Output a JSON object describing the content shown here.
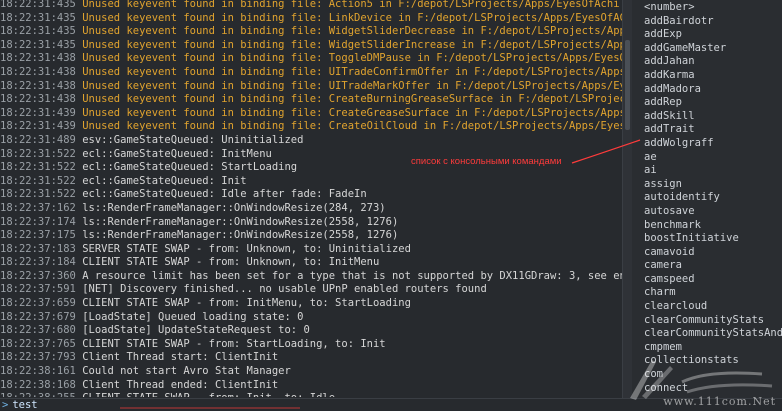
{
  "log": [
    {
      "time": "18:22:31:435",
      "level": "warn",
      "text": "Unused keyevent found in binding file: Action5 in F:/depot/LSProjects/Apps/EyesOfAchi"
    },
    {
      "time": "18:22:31:435",
      "level": "warn",
      "text": "Unused keyevent found in binding file: LinkDevice in F:/depot/LSProjects/Apps/EyesOfAC"
    },
    {
      "time": "18:22:31:435",
      "level": "warn",
      "text": "Unused keyevent found in binding file: WidgetSliderDecrease in F:/depot/LSProjects/App"
    },
    {
      "time": "18:22:31:435",
      "level": "warn",
      "text": "Unused keyevent found in binding file: WidgetSliderIncrease in F:/depot/LSProjects/App"
    },
    {
      "time": "18:22:31:438",
      "level": "warn",
      "text": "Unused keyevent found in binding file: ToggleDMPause in F:/depot/LSProjects/Apps/EyesO"
    },
    {
      "time": "18:22:31:438",
      "level": "warn",
      "text": "Unused keyevent found in binding file: UITradeConfirmOffer in F:/depot/LSProjects/Apps"
    },
    {
      "time": "18:22:31:438",
      "level": "warn",
      "text": "Unused keyevent found in binding file: UITradeMarkOffer in F:/depot/LSProjects/Apps/Ey"
    },
    {
      "time": "18:22:31:438",
      "level": "warn",
      "text": "Unused keyevent found in binding file: CreateBurningGreaseSurface in F:/depot/LSProjec"
    },
    {
      "time": "18:22:31:439",
      "level": "warn",
      "text": "Unused keyevent found in binding file: CreateGreaseSurface in F:/depot/LSProjects/Apps"
    },
    {
      "time": "18:22:31:439",
      "level": "warn",
      "text": "Unused keyevent found in binding file: CreateOilCloud in F:/depot/LSProjects/Apps/Eyes"
    },
    {
      "time": "18:22:31:489",
      "level": "info",
      "text": "esv::GameStateQueued: Uninitialized"
    },
    {
      "time": "18:22:31:522",
      "level": "info",
      "text": "ecl::GameStateQueued: InitMenu"
    },
    {
      "time": "18:22:31:522",
      "level": "info",
      "text": "ecl::GameStateQueued: StartLoading"
    },
    {
      "time": "18:22:31:522",
      "level": "info",
      "text": "ecl::GameStateQueued: Init"
    },
    {
      "time": "18:22:31:522",
      "level": "info",
      "text": "ecl::GameStateQueued: Idle after fade: FadeIn"
    },
    {
      "time": "18:22:37:162",
      "level": "info",
      "text": "ls::RenderFrameManager::OnWindowResize(284, 273)"
    },
    {
      "time": "18:22:37:174",
      "level": "info",
      "text": "ls::RenderFrameManager::OnWindowResize(2558, 1276)"
    },
    {
      "time": "18:22:37:175",
      "level": "info",
      "text": "ls::RenderFrameManager::OnWindowResize(2558, 1276)"
    },
    {
      "time": "18:22:37:183",
      "level": "info",
      "text": "SERVER STATE SWAP - from: Unknown, to: Uninitialized"
    },
    {
      "time": "18:22:37:184",
      "level": "info",
      "text": "CLIENT STATE SWAP - from: Unknown, to: InitMenu"
    },
    {
      "time": "18:22:37:360",
      "level": "info",
      "text": "A resource limit has been set for a type that is not supported by DX11GDraw: 3, see en"
    },
    {
      "time": "18:22:37:591",
      "level": "info",
      "text": "[NET] Discovery finished... no usable UPnP enabled routers found"
    },
    {
      "time": "18:22:37:659",
      "level": "info",
      "text": "CLIENT STATE SWAP - from: InitMenu, to: StartLoading"
    },
    {
      "time": "18:22:37:679",
      "level": "info",
      "text": "[LoadState] Queued loading state: 0"
    },
    {
      "time": "18:22:37:680",
      "level": "info",
      "text": "[LoadState] UpdateStateRequest to: 0"
    },
    {
      "time": "18:22:37:765",
      "level": "info",
      "text": "CLIENT STATE SWAP - from: StartLoading, to: Init"
    },
    {
      "time": "18:22:37:793",
      "level": "info",
      "text": "Client Thread start: ClientInit"
    },
    {
      "time": "18:22:38:161",
      "level": "info",
      "text": "Could not start Avro Stat Manager"
    },
    {
      "time": "18:22:38:168",
      "level": "info",
      "text": "Client Thread ended: ClientInit"
    },
    {
      "time": "18:22:38:255",
      "level": "info",
      "text": "CLIENT STATE SWAP - from: Init, to: Idle"
    }
  ],
  "commands": [
    "<number>",
    "addBairdotr",
    "addExp",
    "addGameMaster",
    "addJahan",
    "addKarma",
    "addMadora",
    "addRep",
    "addSkill",
    "addTrait",
    "addWolgraff",
    "ae",
    "ai",
    "assign",
    "autoidentify",
    "autosave",
    "benchmark",
    "boostInitiative",
    "camavoid",
    "camera",
    "camspeed",
    "charm",
    "clearcloud",
    "clearCommunityStats",
    "clearCommunityStatsAnd",
    "cmpmem",
    "collectionstats",
    "com",
    "connect"
  ],
  "prompt": {
    "symbol": ">",
    "value": "test"
  },
  "annotation": {
    "text": "список с консольными командами"
  },
  "watermark": {
    "site": "www.111com.Net"
  }
}
